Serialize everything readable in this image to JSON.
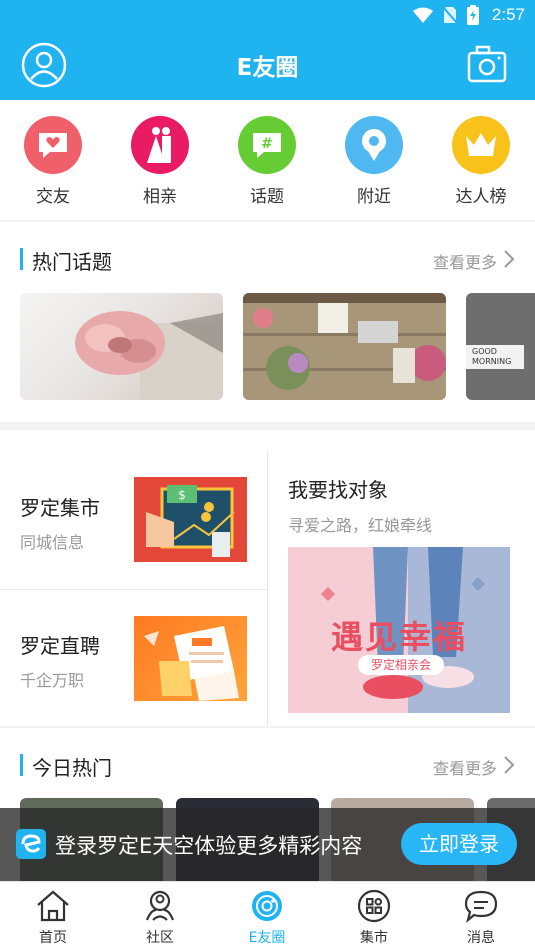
{
  "status_bar": {
    "time": "2:57"
  },
  "header": {
    "title": "E友圈"
  },
  "categories": [
    {
      "label": "交友",
      "color": "#f0606a",
      "icon": "heart-chat-icon"
    },
    {
      "label": "相亲",
      "color": "#e81b63",
      "icon": "couple-icon"
    },
    {
      "label": "话题",
      "color": "#66cc33",
      "icon": "hashtag-icon"
    },
    {
      "label": "附近",
      "color": "#4fb8f0",
      "icon": "location-icon"
    },
    {
      "label": "达人榜",
      "color": "#f8c21b",
      "icon": "crown-icon"
    }
  ],
  "hot_topics": {
    "title": "热门话题",
    "more": "查看更多",
    "good_morning": "GOOD\nMORNING"
  },
  "services": {
    "market": {
      "title": "罗定集市",
      "subtitle": "同城信息"
    },
    "jobs": {
      "title": "罗定直聘",
      "subtitle": "千企万职"
    },
    "dating": {
      "title": "我要找对象",
      "subtitle": "寻爱之路，红娘牵线",
      "banner_main": "遇见幸福",
      "banner_sub": "罗定相亲会"
    }
  },
  "today_hot": {
    "title": "今日热门",
    "more": "查看更多"
  },
  "login_bar": {
    "text": "登录罗定E天空体验更多精彩内容",
    "button": "立即登录"
  },
  "tabbar": [
    {
      "label": "首页",
      "icon": "home-icon",
      "active": false
    },
    {
      "label": "社区",
      "icon": "community-icon",
      "active": false
    },
    {
      "label": "E友圈",
      "icon": "circle-chat-icon",
      "active": true
    },
    {
      "label": "集市",
      "icon": "grid-icon",
      "active": false
    },
    {
      "label": "消息",
      "icon": "message-icon",
      "active": false
    }
  ],
  "colors": {
    "primary": "#1fb3f0"
  }
}
